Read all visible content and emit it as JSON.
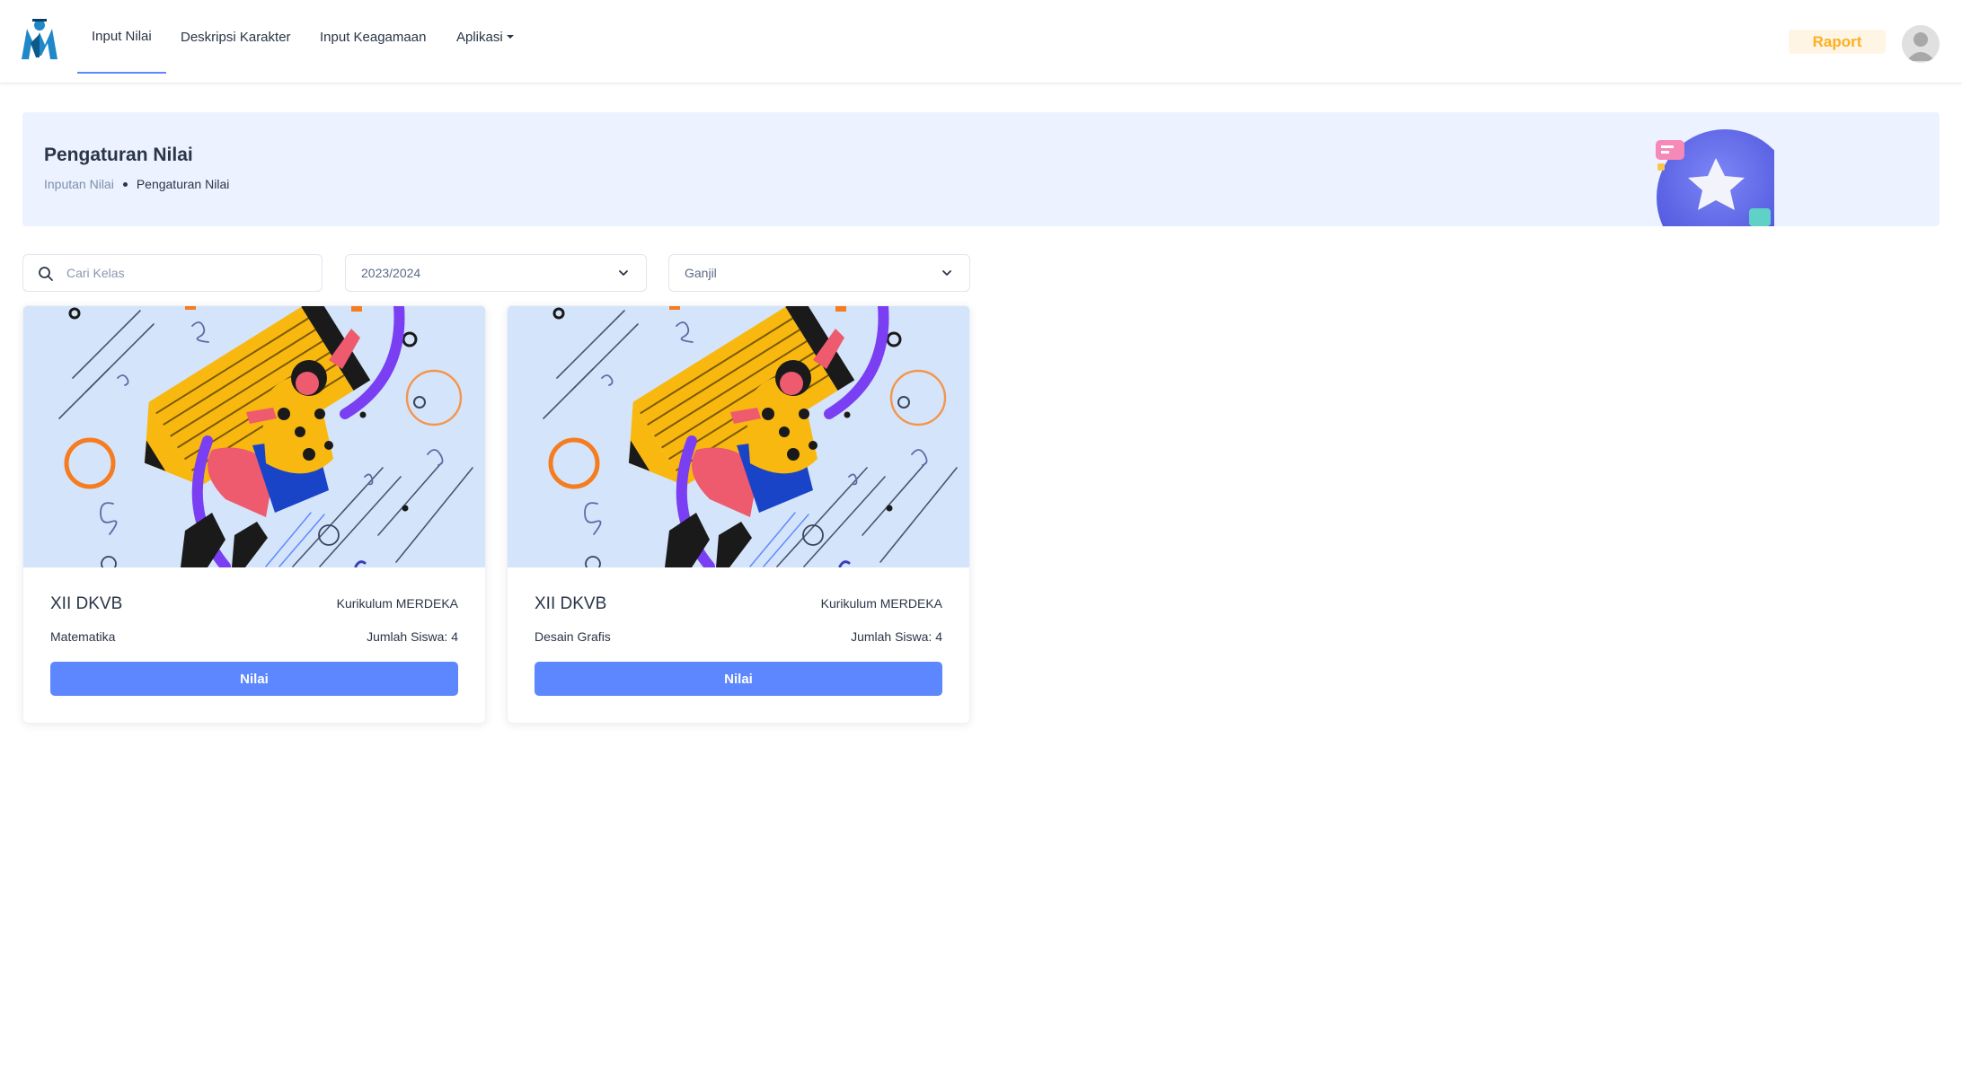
{
  "nav": {
    "items": [
      {
        "label": "Input Nilai"
      },
      {
        "label": "Deskripsi Karakter"
      },
      {
        "label": "Input Keagamaan"
      },
      {
        "label": "Aplikasi"
      }
    ],
    "raport_label": "Raport"
  },
  "banner": {
    "title": "Pengaturan Nilai",
    "breadcrumb": [
      "Inputan Nilai",
      "Pengaturan Nilai"
    ]
  },
  "filters": {
    "search_placeholder": "Cari Kelas",
    "year": "2023/2024",
    "semester": "Ganjil"
  },
  "cards": [
    {
      "class_name": "XII DKVB",
      "curriculum": "Kurikulum MERDEKA",
      "subject": "Matematika",
      "students": "Jumlah Siswa: 4",
      "button": "Nilai"
    },
    {
      "class_name": "XII DKVB",
      "curriculum": "Kurikulum MERDEKA",
      "subject": "Desain Grafis",
      "students": "Jumlah Siswa: 4",
      "button": "Nilai"
    }
  ],
  "colors": {
    "primary": "#5d87ff",
    "warning": "#ffae1f",
    "banner_bg": "#ecf2ff"
  }
}
